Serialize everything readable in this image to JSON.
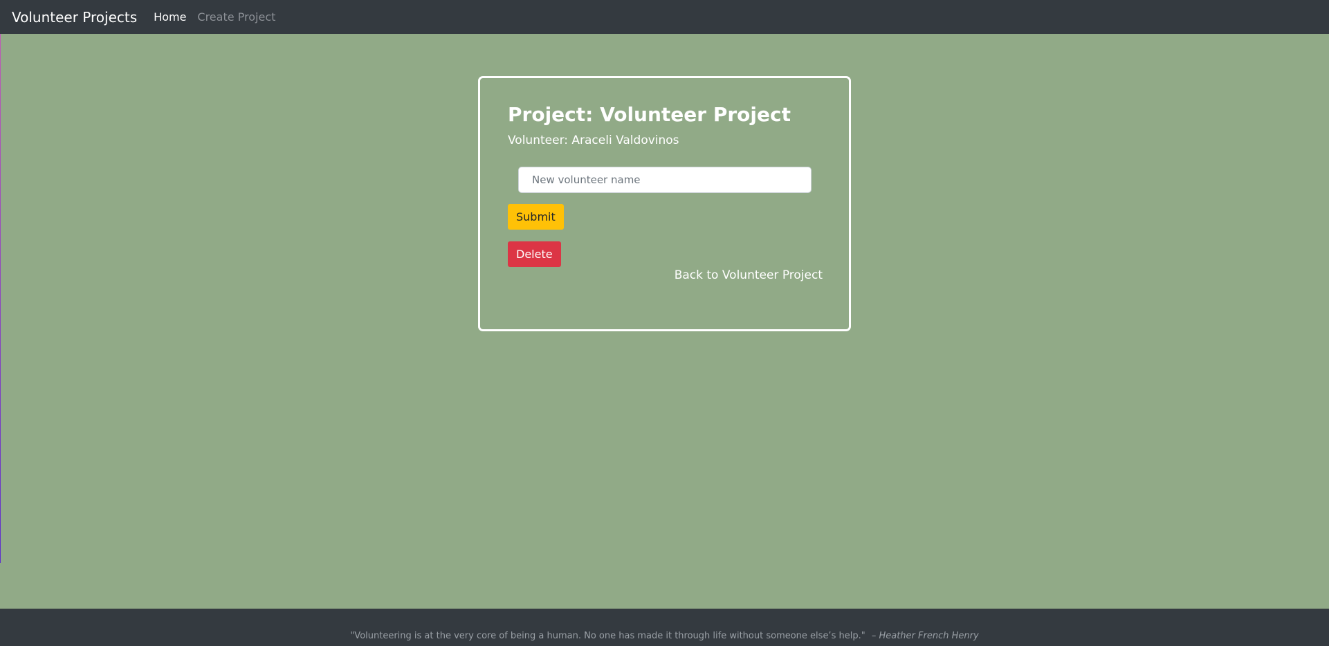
{
  "navbar": {
    "brand": "Volunteer Projects",
    "links": [
      {
        "label": "Home",
        "active": true
      },
      {
        "label": "Create Project",
        "active": false
      }
    ]
  },
  "card": {
    "title": "Project: Volunteer Project",
    "subtitle": "Volunteer: Araceli Valdovinos",
    "input": {
      "value": "",
      "placeholder": "New volunteer name"
    },
    "submit_label": "Submit",
    "delete_label": "Delete",
    "back_link": "Back to Volunteer Project"
  },
  "footer": {
    "quote": "\"Volunteering is at the very core of being a human. No one has made it through life without someone else’s help.\"",
    "author": "– Heather French Henry"
  },
  "colors": {
    "page_background": "#91aa87",
    "navbar_background": "#343a40",
    "submit_button": "#ffc107",
    "delete_button": "#dc3545"
  }
}
